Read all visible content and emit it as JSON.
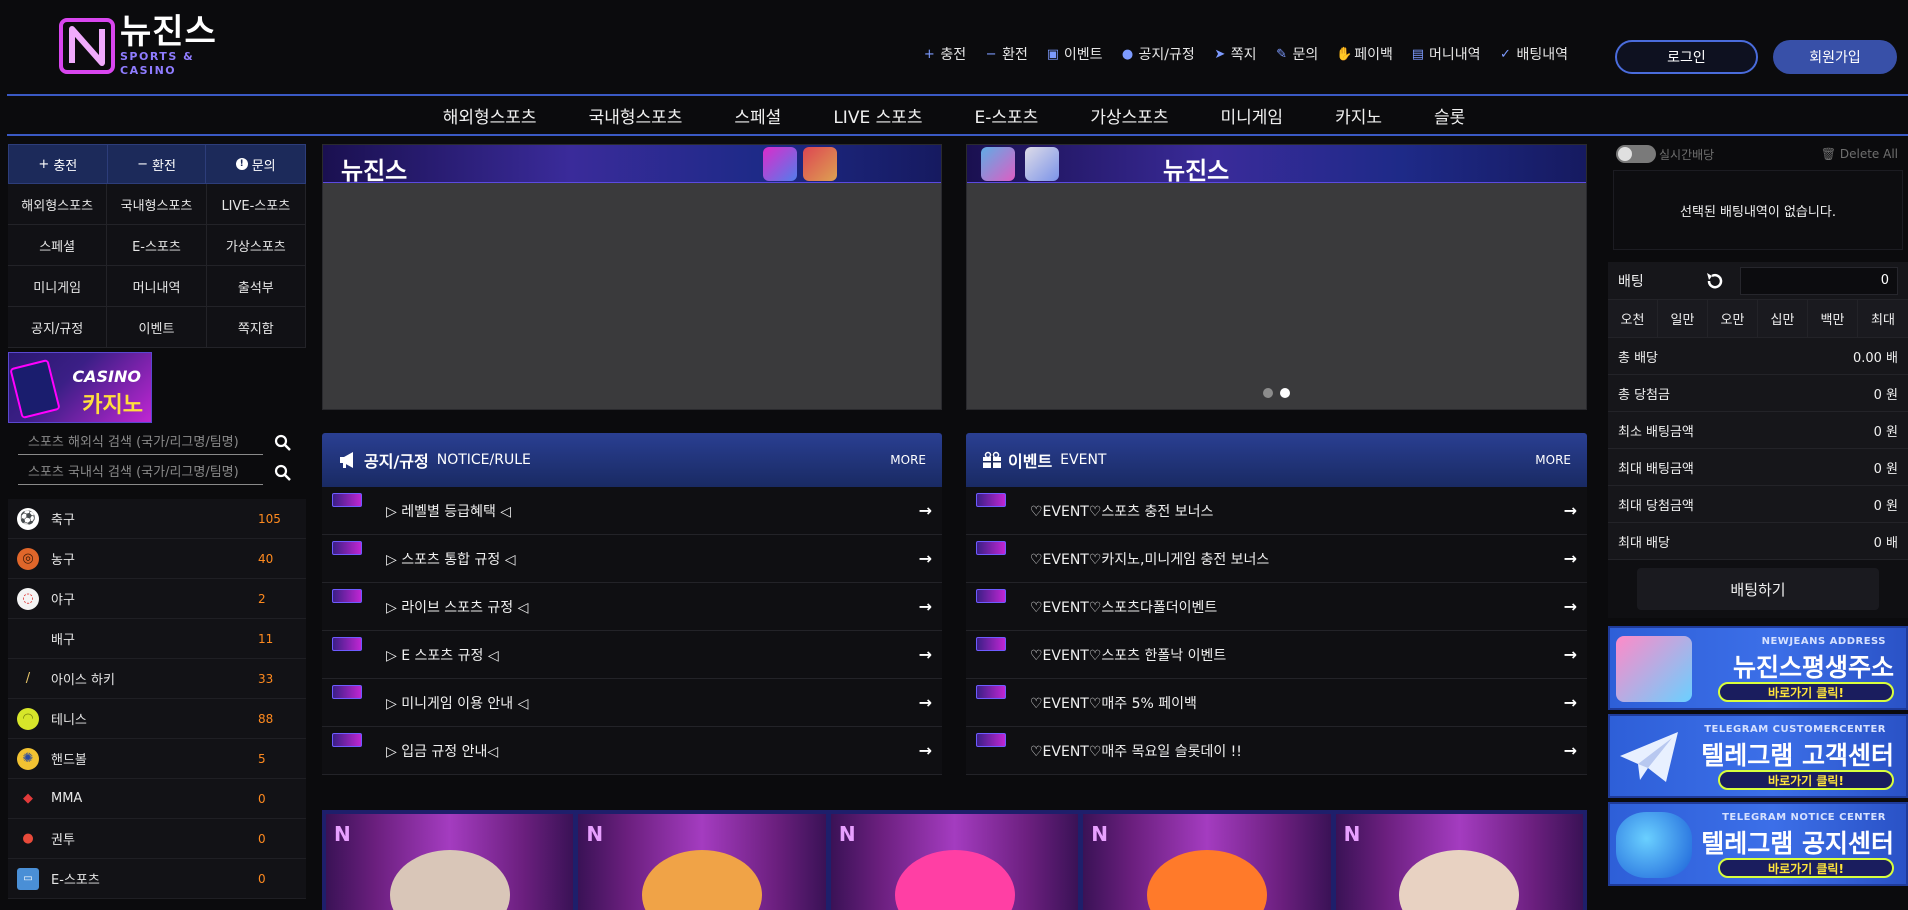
{
  "header": {
    "logo_main": "뉴진스",
    "logo_sub": "SPORTS & CASINO",
    "links": [
      {
        "icon": "plus-icon",
        "label": "충전"
      },
      {
        "icon": "minus-icon",
        "label": "환전"
      },
      {
        "icon": "calendar-icon",
        "label": "이벤트"
      },
      {
        "icon": "info-icon",
        "label": "공지/규정"
      },
      {
        "icon": "paper-plane-icon",
        "label": "쪽지"
      },
      {
        "icon": "edit-icon",
        "label": "문의"
      },
      {
        "icon": "hand-coin-icon",
        "label": "페이백"
      },
      {
        "icon": "clipboard-icon",
        "label": "머니내역"
      },
      {
        "icon": "check-icon",
        "label": "배팅내역"
      }
    ],
    "login": "로그인",
    "join": "회원가입"
  },
  "nav": [
    "해외형스포츠",
    "국내형스포츠",
    "스페셜",
    "LIVE 스포츠",
    "E-스포츠",
    "가상스포츠",
    "미니게임",
    "카지노",
    "슬롯"
  ],
  "left": {
    "top_buttons": [
      {
        "icon": "plus-icon",
        "label": "충전"
      },
      {
        "icon": "minus-icon",
        "label": "환전"
      },
      {
        "icon": "info-icon",
        "label": "문의"
      }
    ],
    "grid": [
      "해외형스포츠",
      "국내형스포츠",
      "LIVE-스포츠",
      "스페셜",
      "E-스포츠",
      "가상스포츠",
      "미니게임",
      "머니내역",
      "출석부",
      "공지/규정",
      "이벤트",
      "쪽지함"
    ],
    "casino_banner": {
      "line1": "CASINO",
      "line2": "카지노"
    },
    "search_overseas": "스포츠 해외식 검색 (국가/리그명/팀명)",
    "search_domestic": "스포츠 국내식 검색 (국가/리그명/팀명)",
    "sports": [
      {
        "icon": "soccer-icon",
        "name": "축구",
        "count": "105"
      },
      {
        "icon": "basketball-icon",
        "name": "농구",
        "count": "40"
      },
      {
        "icon": "baseball-icon",
        "name": "야구",
        "count": "2"
      },
      {
        "icon": "volleyball-icon",
        "name": "배구",
        "count": "11"
      },
      {
        "icon": "hockey-icon",
        "name": "아이스 하키",
        "count": "33"
      },
      {
        "icon": "tennis-icon",
        "name": "테니스",
        "count": "88"
      },
      {
        "icon": "handball-icon",
        "name": "핸드볼",
        "count": "5"
      },
      {
        "icon": "mma-icon",
        "name": "MMA",
        "count": "0"
      },
      {
        "icon": "boxing-icon",
        "name": "권투",
        "count": "0"
      },
      {
        "icon": "esports-icon",
        "name": "E-스포츠",
        "count": "0"
      }
    ]
  },
  "banners": {
    "logo_text": "뉴진스"
  },
  "notice": {
    "title": "공지/규정",
    "subtitle": "NOTICE/RULE",
    "more": "MORE",
    "rows": [
      "▷ 레벨별 등급혜택 ◁",
      "▷ 스포츠 통합 규정 ◁",
      "▷ 라이브 스포츠 규정 ◁",
      "▷ E 스포츠 규정 ◁",
      "▷ 미니게임 이용 안내 ◁",
      "▷ 입금 규정 안내◁"
    ]
  },
  "event": {
    "title": "이벤트",
    "subtitle": "EVENT",
    "more": "MORE",
    "rows": [
      "♡EVENT♡스포츠 충전 보너스",
      "♡EVENT♡카지노,미니게임 충전 보너스",
      "♡EVENT♡스포츠다폴더이벤트",
      "♡EVENT♡스포츠 한폴낙 이벤트",
      "♡EVENT♡매주 5% 페이백",
      "♡EVENT♡매주 목요일 슬롯데이 !!"
    ]
  },
  "games": {
    "card_mark": "N"
  },
  "right": {
    "toggle_label": "실시간배당",
    "delete_all": "Delete All",
    "empty_text": "선택된 배팅내역이 없습니다.",
    "bet_label": "배팅",
    "bet_value": "0",
    "quick": [
      "오천",
      "일만",
      "오만",
      "십만",
      "백만",
      "최대"
    ],
    "info": [
      {
        "label": "총 배당",
        "value": "0.00 배"
      },
      {
        "label": "총 당첨금",
        "value": "0 원"
      },
      {
        "label": "최소 배팅금액",
        "value": "0 원"
      },
      {
        "label": "최대 배팅금액",
        "value": "0 원"
      },
      {
        "label": "최대 당첨금액",
        "value": "0 원"
      },
      {
        "label": "최대 배당",
        "value": "0 배"
      }
    ],
    "bet_button": "배팅하기",
    "side_banners": [
      {
        "small": "NEWJEANS ADDRESS",
        "big": "뉴진스평생주소",
        "btn": "바로가기 클릭!"
      },
      {
        "small": "TELEGRAM CUSTOMERCENTER",
        "big": "텔레그램 고객센터",
        "btn": "바로가기 클릭!"
      },
      {
        "small": "TELEGRAM NOTICE CENTER",
        "big": "텔레그램 공지센터",
        "btn": "바로가기 클릭!"
      }
    ]
  },
  "colors": {
    "accent": "#3a59c4",
    "board_head": "#1f3175",
    "count": "#ff8a1f"
  }
}
